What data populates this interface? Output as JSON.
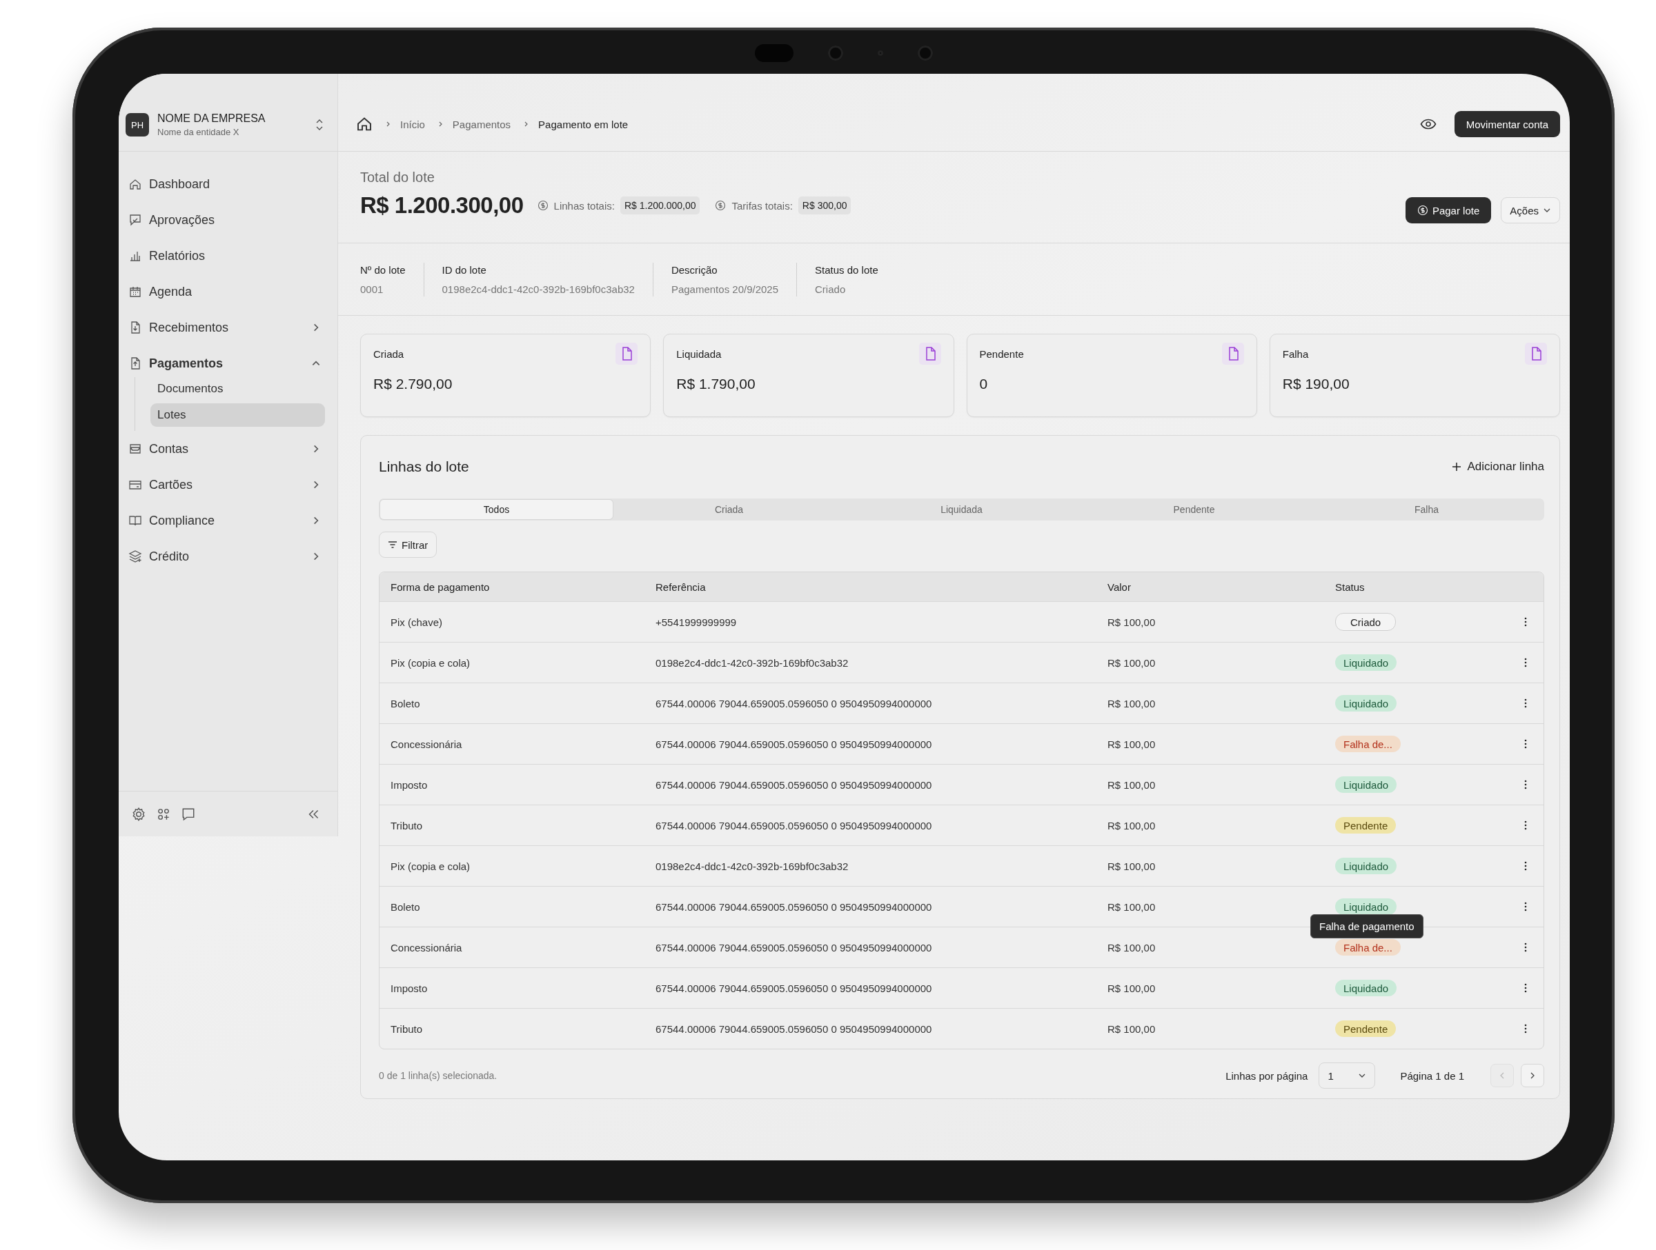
{
  "company": {
    "initials": "PH",
    "name": "NOME DA EMPRESA",
    "entity": "Nome da entidade X"
  },
  "sidebar": {
    "items": [
      {
        "label": "Dashboard",
        "selected": false
      },
      {
        "label": "Aprovações",
        "selected": false
      },
      {
        "label": "Relatórios",
        "selected": false
      },
      {
        "label": "Agenda",
        "selected": false
      },
      {
        "label": "Recebimentos",
        "selected": false,
        "expanded": false
      },
      {
        "label": "Pagamentos",
        "selected": false,
        "expanded": true,
        "children": [
          {
            "label": "Documentos",
            "selected": false
          },
          {
            "label": "Lotes",
            "selected": true
          }
        ]
      },
      {
        "label": "Contas",
        "selected": false,
        "expanded": false
      },
      {
        "label": "Cartões",
        "selected": false,
        "expanded": false
      },
      {
        "label": "Compliance",
        "selected": false,
        "expanded": false
      },
      {
        "label": "Crédito",
        "selected": false,
        "expanded": false
      }
    ]
  },
  "breadcrumb": [
    "Início",
    "Pagamentos",
    "Pagamento em lote"
  ],
  "header_button": "Movimentar conta",
  "batch": {
    "title": "Total do lote",
    "total": "R$ 1.200.300,00",
    "lines_label": "Linhas totais:",
    "lines_value": "R$ 1.200.000,00",
    "fees_label": "Tarifas totais:",
    "fees_value": "R$ 300,00",
    "pay_button": "Pagar lote",
    "actions_button": "Ações"
  },
  "details": [
    {
      "label": "Nº do lote",
      "value": "0001"
    },
    {
      "label": "ID do lote",
      "value": "0198e2c4-ddc1-42c0-392b-169bf0c3ab32"
    },
    {
      "label": "Descrição",
      "value": "Pagamentos 20/9/2025"
    },
    {
      "label": "Status do lote",
      "value": "Criado"
    }
  ],
  "summary_cards": [
    {
      "label": "Criada",
      "value": "R$ 2.790,00"
    },
    {
      "label": "Liquidada",
      "value": "R$ 1.790,00"
    },
    {
      "label": "Pendente",
      "value": "0"
    },
    {
      "label": "Falha",
      "value": "R$ 190,00"
    }
  ],
  "lines": {
    "title": "Linhas do lote",
    "add_button": "Adicionar linha",
    "tabs": [
      {
        "label": "Todos",
        "selected": true
      },
      {
        "label": "Criada",
        "selected": false
      },
      {
        "label": "Liquidada",
        "selected": false
      },
      {
        "label": "Pendente",
        "selected": false
      },
      {
        "label": "Falha",
        "selected": false
      }
    ],
    "filter_button": "Filtrar",
    "columns": [
      "Forma de pagamento",
      "Referência",
      "Valor",
      "Status"
    ],
    "rows": [
      {
        "method": "Pix (chave)",
        "reference": "+5541999999999",
        "value": "R$ 100,00",
        "status": {
          "label": "Criado",
          "kind": "created"
        }
      },
      {
        "method": "Pix (copia e cola)",
        "reference": "0198e2c4-ddc1-42c0-392b-169bf0c3ab32",
        "value": "R$ 100,00",
        "status": {
          "label": "Liquidado",
          "kind": "settled"
        }
      },
      {
        "method": "Boleto",
        "reference": "67544.00006 79044.659005.0596050 0 9504950994000000",
        "value": "R$ 100,00",
        "status": {
          "label": "Liquidado",
          "kind": "settled"
        }
      },
      {
        "method": "Concessionária",
        "reference": "67544.00006 79044.659005.0596050 0 9504950994000000",
        "value": "R$ 100,00",
        "status": {
          "label": "Falha de...",
          "kind": "failed"
        }
      },
      {
        "method": "Imposto",
        "reference": "67544.00006 79044.659005.0596050 0 9504950994000000",
        "value": "R$ 100,00",
        "status": {
          "label": "Liquidado",
          "kind": "settled"
        }
      },
      {
        "method": "Tributo",
        "reference": "67544.00006 79044.659005.0596050 0 9504950994000000",
        "value": "R$ 100,00",
        "status": {
          "label": "Pendente",
          "kind": "pending"
        }
      },
      {
        "method": "Pix (copia e cola)",
        "reference": "0198e2c4-ddc1-42c0-392b-169bf0c3ab32",
        "value": "R$ 100,00",
        "status": {
          "label": "Liquidado",
          "kind": "settled"
        }
      },
      {
        "method": "Boleto",
        "reference": "67544.00006 79044.659005.0596050 0 9504950994000000",
        "value": "R$ 100,00",
        "status": {
          "label": "Liquidado",
          "kind": "settled"
        }
      },
      {
        "method": "Concessionária",
        "reference": "67544.00006 79044.659005.0596050 0 9504950994000000",
        "value": "R$ 100,00",
        "status": {
          "label": "Falha de...",
          "kind": "failed",
          "tooltip": "Falha de pagamento"
        }
      },
      {
        "method": "Imposto",
        "reference": "67544.00006 79044.659005.0596050 0 9504950994000000",
        "value": "R$ 100,00",
        "status": {
          "label": "Liquidado",
          "kind": "settled"
        }
      },
      {
        "method": "Tributo",
        "reference": "67544.00006 79044.659005.0596050 0 9504950994000000",
        "value": "R$ 100,00",
        "status": {
          "label": "Pendente",
          "kind": "pending"
        }
      }
    ],
    "selection_info": "0 de 1 linha(s) selecionada.",
    "rows_per_page_label": "Linhas por página",
    "rows_per_page": "1",
    "page_info": "Página 1 de 1",
    "pager": [
      {
        "kind": "previous",
        "disabled": true
      },
      {
        "kind": "next",
        "disabled": false
      }
    ]
  }
}
